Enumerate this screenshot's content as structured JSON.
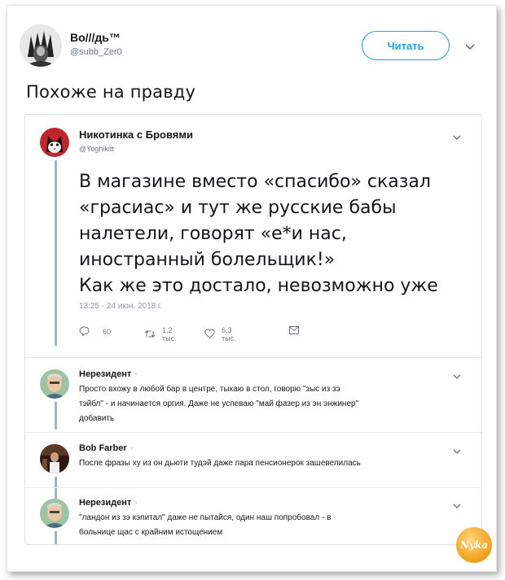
{
  "tweet": {
    "author_name": "Во///дь™",
    "author_handle": "@subb_Zer0",
    "follow_label": "Читать",
    "text": "Похоже на правду"
  },
  "quoted": {
    "author_name": "Никотинка с Бровями",
    "author_handle": "@Yoghikitt",
    "lines": [
      "В магазине вместо «спасибо» сказал",
      "«грасиас» и тут же русские бабы",
      "налетели, говорят «е*и нас,",
      "иностранный болельщик!»",
      "Как же это достало, невозможно уже"
    ],
    "timestamp": "13:25 - 24 июн. 2018 г.",
    "replies_count": "60",
    "retweets_count": "1,2 тыс.",
    "likes_count": "6,3 тыс."
  },
  "replies": [
    {
      "author_name": "Нерезидент",
      "lines": [
        "Просто вхожу в любой бар в центре, тыкаю в стол, говорю \"зыс из зэ",
        "тэйбл\" - и начинается оргия. Даже не успеваю \"май фазер из эн энжинер\"",
        "добавить"
      ]
    },
    {
      "author_name": "Bob Farber",
      "lines": [
        "После фразы ху из он дьюти тудэй даже пара пенсионерок зашевелилась"
      ]
    },
    {
      "author_name": "Нерезидент",
      "lines": [
        "\"ландон из зэ кэпитал\" даже не пытайся, один наш попробовал - в",
        "больнице щас с крайним истощением"
      ]
    }
  ],
  "watermark": "Nyka",
  "colors": {
    "accent": "#1da1f2",
    "thread_line": "#a8b4bd",
    "muted": "#657786",
    "border": "#d9dfe4",
    "watermark_bg": "#f5a623"
  },
  "icons": {
    "reply": "reply-icon",
    "retweet": "retweet-icon",
    "like": "heart-icon",
    "dm": "envelope-icon",
    "menu": "chevron-down-icon"
  }
}
